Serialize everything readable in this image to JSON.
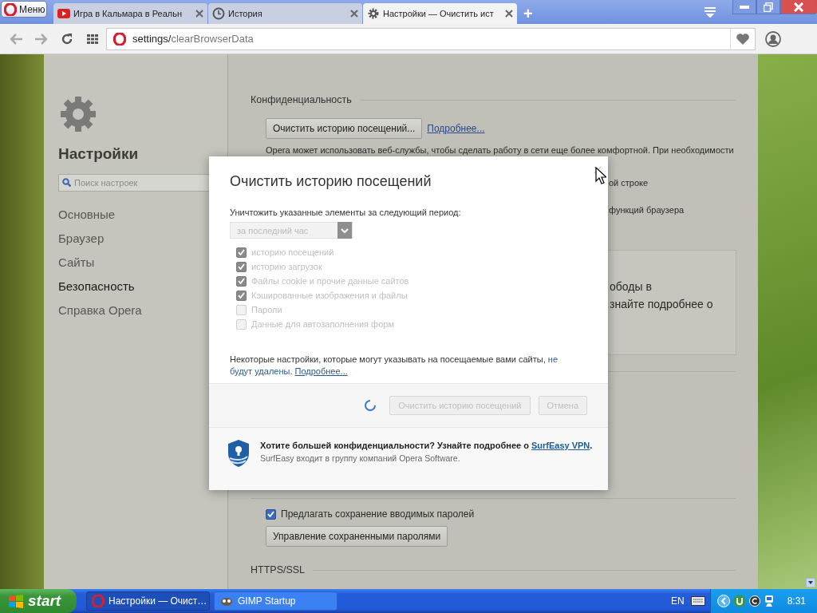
{
  "tab_strip": {
    "menu_button": "Меню",
    "tabs": [
      {
        "title": "Игра в Кальмара в Реальн",
        "selected": false
      },
      {
        "title": "История",
        "selected": false
      },
      {
        "title": "Настройки — Очистить ист",
        "selected": true
      }
    ],
    "new_tab": "+"
  },
  "address_bar": {
    "url_host": "settings/",
    "url_path": "clearBrowserData"
  },
  "sidebar": {
    "title": "Настройки",
    "search": {
      "placeholder": "Поиск настроек"
    },
    "items": [
      {
        "label": "Основные",
        "selected": false
      },
      {
        "label": "Браузер",
        "selected": false
      },
      {
        "label": "Сайты",
        "selected": false
      },
      {
        "label": "Безопасность",
        "selected": true
      },
      {
        "label": "Справка Opera",
        "selected": false
      }
    ]
  },
  "privacy": {
    "heading": "Конфиденциальность",
    "clear_button": "Очистить историю посещений...",
    "more_link": "Подробнее...",
    "description": "Opera может использовать веб-службы, чтобы сделать работу в сети еще более комфортной. При необходимости",
    "fragments": [
      "ой строке",
      "функций браузера"
    ],
    "panel_lines": [
      "ободы в",
      "знайте подробнее о"
    ]
  },
  "passwords": {
    "offer_save": {
      "label": "Предлагать сохранение вводимых паролей",
      "checked": true
    },
    "manage_button": "Управление сохраненными паролями",
    "heading": "HTTPS/SSL"
  },
  "dialog": {
    "title": "Очистить историю посещений",
    "period_label": "Уничтожить указанные элементы за следующий период:",
    "period": {
      "value": "за последний час",
      "disabled": true
    },
    "options": [
      {
        "label": "историю посещений",
        "checked": true,
        "disabled": true
      },
      {
        "label": "историю загрузок",
        "checked": true,
        "disabled": true
      },
      {
        "label": "Файлы cookie и прочие данные сайтов",
        "checked": true,
        "disabled": true
      },
      {
        "label": "Кэшированные изображения и файлы",
        "checked": true,
        "disabled": true
      },
      {
        "label": "Пароли",
        "checked": false,
        "disabled": true
      },
      {
        "label": "Данные для автозаполнения форм",
        "checked": false,
        "disabled": true
      }
    ],
    "note": {
      "text": "Некоторые настройки, которые могут указывать на посещаемые вами сайты,",
      "highlight": "не будут удалены",
      "after": ".",
      "link": "Подробнее..."
    },
    "buttons": [
      {
        "label": "Очистить историю посещений",
        "disabled": true
      },
      {
        "label": "Отмена",
        "disabled": true
      }
    ],
    "promo": {
      "text": "Хотите большей конфиденциальности? Узнайте подробнее о",
      "link": "SurfEasy VPN",
      "after": ".",
      "subtext": "SurfEasy входит в группу компаний Opera Software."
    }
  },
  "taskbar": {
    "start": "start",
    "tasks": [
      {
        "title": "Настройки — Очист…",
        "selected": true
      },
      {
        "title": "GIMP Startup",
        "selected": false
      }
    ],
    "language": "EN",
    "clock": "8:31"
  }
}
